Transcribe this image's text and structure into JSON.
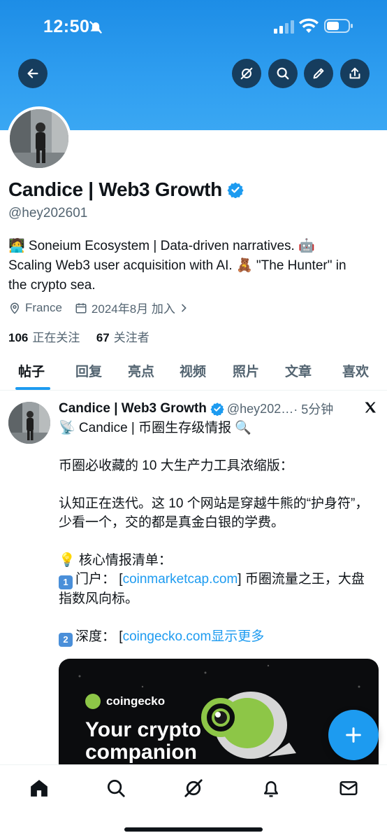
{
  "status_bar": {
    "time": "12:50"
  },
  "profile": {
    "name": "Candice | Web3 Growth",
    "handle": "@hey202601",
    "bio_line1": "🧑‍💻 Soneium Ecosystem | Data-driven narratives. 🤖",
    "bio_line2": "Scaling Web3 user acquisition with AI. 🧸 \"The Hunter\" in",
    "bio_line3": "the crypto sea.",
    "location": "France",
    "joined": "2024年8月 加入",
    "following_count": "106",
    "following_label": "正在关注",
    "followers_count": "67",
    "followers_label": "关注者"
  },
  "tabs": [
    "帖子",
    "回复",
    "亮点",
    "视频",
    "照片",
    "文章",
    "喜欢"
  ],
  "post": {
    "author": "Candice | Web3 Growth",
    "handle": "@hey202…",
    "time": "· 5分钟",
    "line1": "📡 Candice | 币圈生存级情报 🔍",
    "line2": "币圈必收藏的 10 大生产力工具浓缩版：",
    "line3": "认知正在迭代。这 10 个网站是穿越牛熊的“护身符”，少看一个，交的都是真金白银的学费。",
    "line4": "💡 核心情报清单：",
    "item1_num": "1",
    "item1_prefix": "门户：  [",
    "item1_link": "coinmarketcap.com",
    "item1_suffix": "] 币圈流量之王，大盘指数风向标。",
    "item2_num": "2",
    "item2_prefix": "深度：  [",
    "item2_link": "coingecko.com",
    "show_more": "显示更多",
    "card_brand": "coingecko",
    "card_tagline_1": "Your crypto",
    "card_tagline_2": "companion"
  },
  "icons": {
    "back": "back-arrow-icon",
    "grok": "grok-icon",
    "search": "search-icon",
    "edit": "pencil-icon",
    "share": "share-icon",
    "verified": "verified-badge-icon",
    "location": "location-pin-icon",
    "calendar": "calendar-icon",
    "compose": "plus-icon"
  },
  "colors": {
    "accent": "#1d9bf0",
    "banner": "#2f9ef0",
    "muted": "#536471",
    "text": "#0f1419"
  }
}
